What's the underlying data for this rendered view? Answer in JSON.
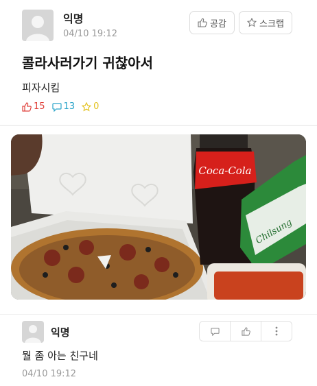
{
  "post": {
    "author": "익명",
    "datetime": "04/10 19:12",
    "like_label": "공감",
    "scrap_label": "스크랩",
    "title": "콜라사러가기 귀찮아서",
    "body": "피자시킴",
    "counts": {
      "likes": "15",
      "comments": "13",
      "scraps": "0"
    },
    "photo": {
      "cola_label": "Coca-Cola",
      "cider_label": "Chilsung"
    }
  },
  "comment": {
    "author": "익명",
    "text": "뭘 좀 아는 친구네",
    "datetime": "04/10 19:12"
  },
  "colors": {
    "like": "#e0403a",
    "comment": "#2aa4c9",
    "scrap": "#e3c21f"
  }
}
